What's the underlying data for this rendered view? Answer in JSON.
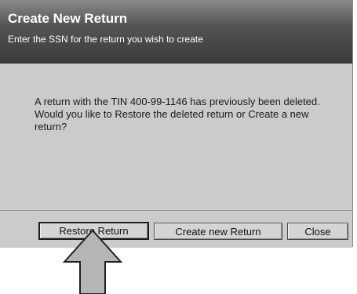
{
  "dialog": {
    "title": "Create New Return",
    "subtitle": "Enter the SSN for the return you wish to create",
    "message": "A return with the TIN 400-99-1146 has previously been deleted. Would you like to Restore the deleted return or Create a new return?"
  },
  "buttons": {
    "restore_label": "Restore Return",
    "create_label": "Create new Return",
    "close_label": "Close"
  },
  "colors": {
    "header_dark": "#3a3a3a",
    "dialog_body": "#cbcbcb",
    "arrow_fill": "#b5b5b5"
  },
  "icons": {
    "callout": "pointer-arrow-icon"
  }
}
